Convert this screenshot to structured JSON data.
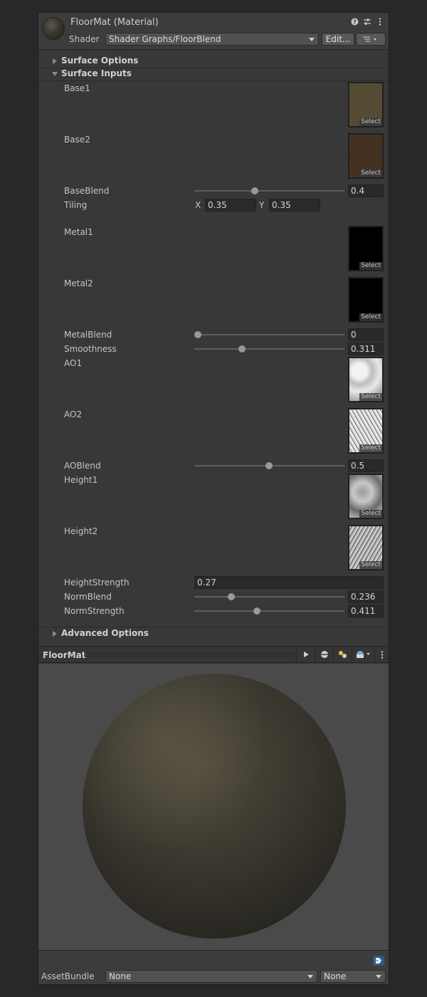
{
  "header": {
    "title": "FloorMat (Material)",
    "shader_label": "Shader",
    "shader_value": "Shader Graphs/FloorBlend",
    "edit_label": "Edit...",
    "icons": [
      "help-icon",
      "preset-sliders-icon",
      "more-vert-icon",
      "list-menu-icon"
    ]
  },
  "foldouts": {
    "surface_options": "Surface Options",
    "surface_inputs": "Surface Inputs",
    "advanced_options": "Advanced Options"
  },
  "select_label": "Select",
  "props": {
    "base1": "Base1",
    "base2": "Base2",
    "baseblend": {
      "label": "BaseBlend",
      "value": "0.4"
    },
    "tiling": {
      "label": "Tiling",
      "x_label": "X",
      "x": "0.35",
      "y_label": "Y",
      "y": "0.35"
    },
    "metal1": "Metal1",
    "metal2": "Metal2",
    "metalblend": {
      "label": "MetalBlend",
      "value": "0"
    },
    "smoothness": {
      "label": "Smoothness",
      "value": "0.311"
    },
    "ao1": "AO1",
    "ao2": "AO2",
    "aoblend": {
      "label": "AOBlend",
      "value": "0.5"
    },
    "height1": "Height1",
    "height2": "Height2",
    "heightstrength": {
      "label": "HeightStrength",
      "value": "0.27"
    },
    "normblend": {
      "label": "NormBlend",
      "value": "0.236"
    },
    "normstrength": {
      "label": "NormStrength",
      "value": "0.411"
    }
  },
  "preview": {
    "title": "FloorMat",
    "buttons": [
      "play-icon",
      "sphere-mesh-icon",
      "lighting-icon",
      "environment-icon",
      "more-vert-icon"
    ]
  },
  "footer": {
    "assetbundle_label": "AssetBundle",
    "bundle_name": "None",
    "bundle_variant": "None"
  },
  "colors": {
    "panel_bg": "#383838",
    "field_bg": "#2a2a2a",
    "tag_icon": "#2c5d87"
  }
}
